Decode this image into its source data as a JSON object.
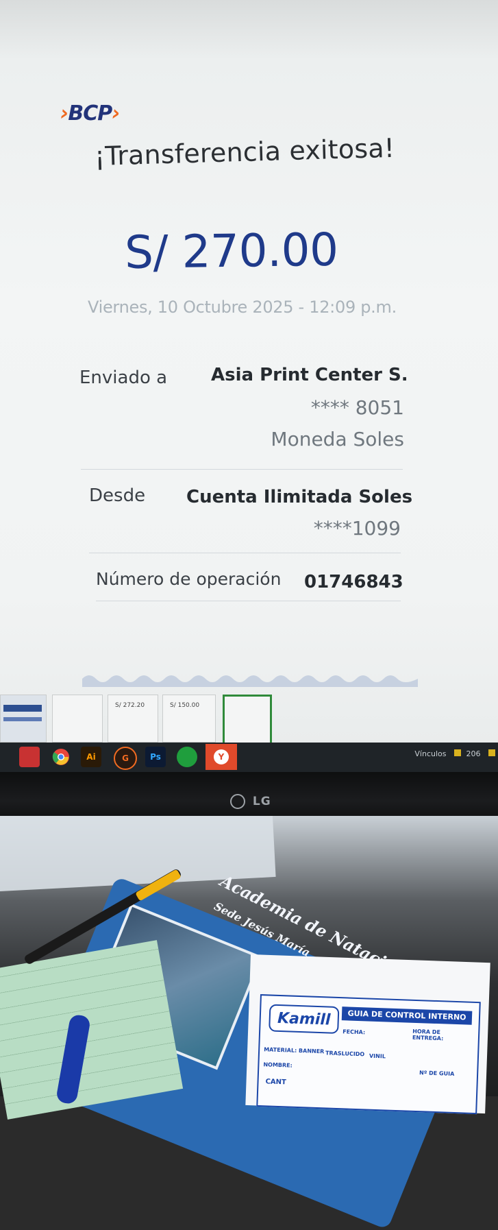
{
  "screen": {
    "logo": ">BCP>",
    "title": "¡Transferencia exitosa!",
    "amount": "S/ 270.00",
    "datetime": "Viernes, 10 Octubre 2025 - 12:09 p.m.",
    "sent_to": {
      "label": "Enviado a",
      "name": "Asia Print Center S.",
      "account": "**** 8051",
      "currency": "Moneda Soles"
    },
    "from": {
      "label": "Desde",
      "name": "Cuenta Ilimitada Soles",
      "account": "****1099"
    },
    "operation": {
      "label": "Número de operación",
      "number": "01746843"
    }
  },
  "thumbnails": [
    "",
    "",
    "S/ 272.20",
    "S/ 150.00",
    ""
  ],
  "taskbar": {
    "icons": [
      "generic-app-icon",
      "chrome-icon",
      "illustrator-icon",
      "antivirus-icon",
      "photoshop-icon",
      "whatsapp-icon",
      "yandex-icon"
    ],
    "icon_labels": [
      "",
      "",
      "Ai",
      "G",
      "Ps",
      "",
      "Y"
    ],
    "tray_label": "Vínculos",
    "tray_count": "206"
  },
  "monitor": {
    "brand": "LG"
  },
  "desk": {
    "flyer_title": "Academia de Natación",
    "flyer_subtitle": "Sede Jesús María",
    "guia_brand": "Kamill",
    "guia_title": "GUIA DE CONTROL INTERNO",
    "guia_fields": [
      "FECHA:",
      "HORA DE ENTREGA:",
      "MATERIAL: BANNER",
      "TRASLUCIDO",
      "VINIL",
      "NOMBRE:",
      "Nº DE GUIA",
      "CANT"
    ]
  }
}
